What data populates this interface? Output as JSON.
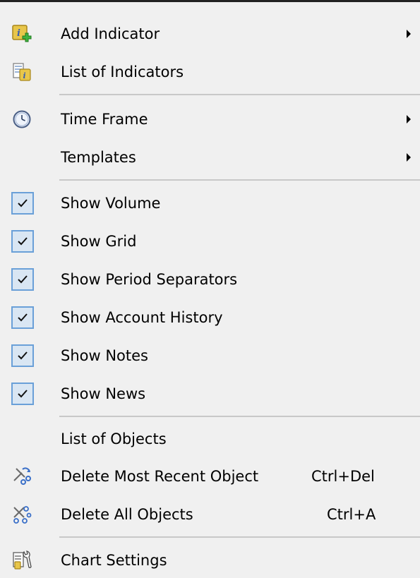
{
  "menu": {
    "add_indicator": {
      "label": "Add Indicator",
      "icon": "add-indicator-icon"
    },
    "list_of_indicators": {
      "label": "List of Indicators",
      "icon": "indicators-list-icon"
    },
    "time_frame": {
      "label": "Time Frame",
      "icon": "clock-icon"
    },
    "templates": {
      "label": "Templates"
    },
    "show_volume": {
      "label": "Show Volume",
      "checked": true
    },
    "show_grid": {
      "label": "Show Grid",
      "checked": true
    },
    "show_period_separators": {
      "label": "Show Period Separators",
      "checked": true
    },
    "show_account_history": {
      "label": "Show Account History",
      "checked": true
    },
    "show_notes": {
      "label": "Show Notes",
      "checked": true
    },
    "show_news": {
      "label": "Show News",
      "checked": true
    },
    "list_of_objects": {
      "label": "List of Objects"
    },
    "delete_most_recent_object": {
      "label": "Delete Most Recent Object",
      "shortcut": "Ctrl+Del",
      "icon": "delete-recent-object-icon"
    },
    "delete_all_objects": {
      "label": "Delete All Objects",
      "shortcut": "Ctrl+A",
      "icon": "delete-all-objects-icon"
    },
    "chart_settings": {
      "label": "Chart Settings",
      "icon": "chart-settings-icon"
    }
  },
  "colors": {
    "background": "#f0f0f0",
    "check_border": "#6aa0d8",
    "check_fill": "#d9e6f3",
    "separator": "#c8c8c8"
  }
}
